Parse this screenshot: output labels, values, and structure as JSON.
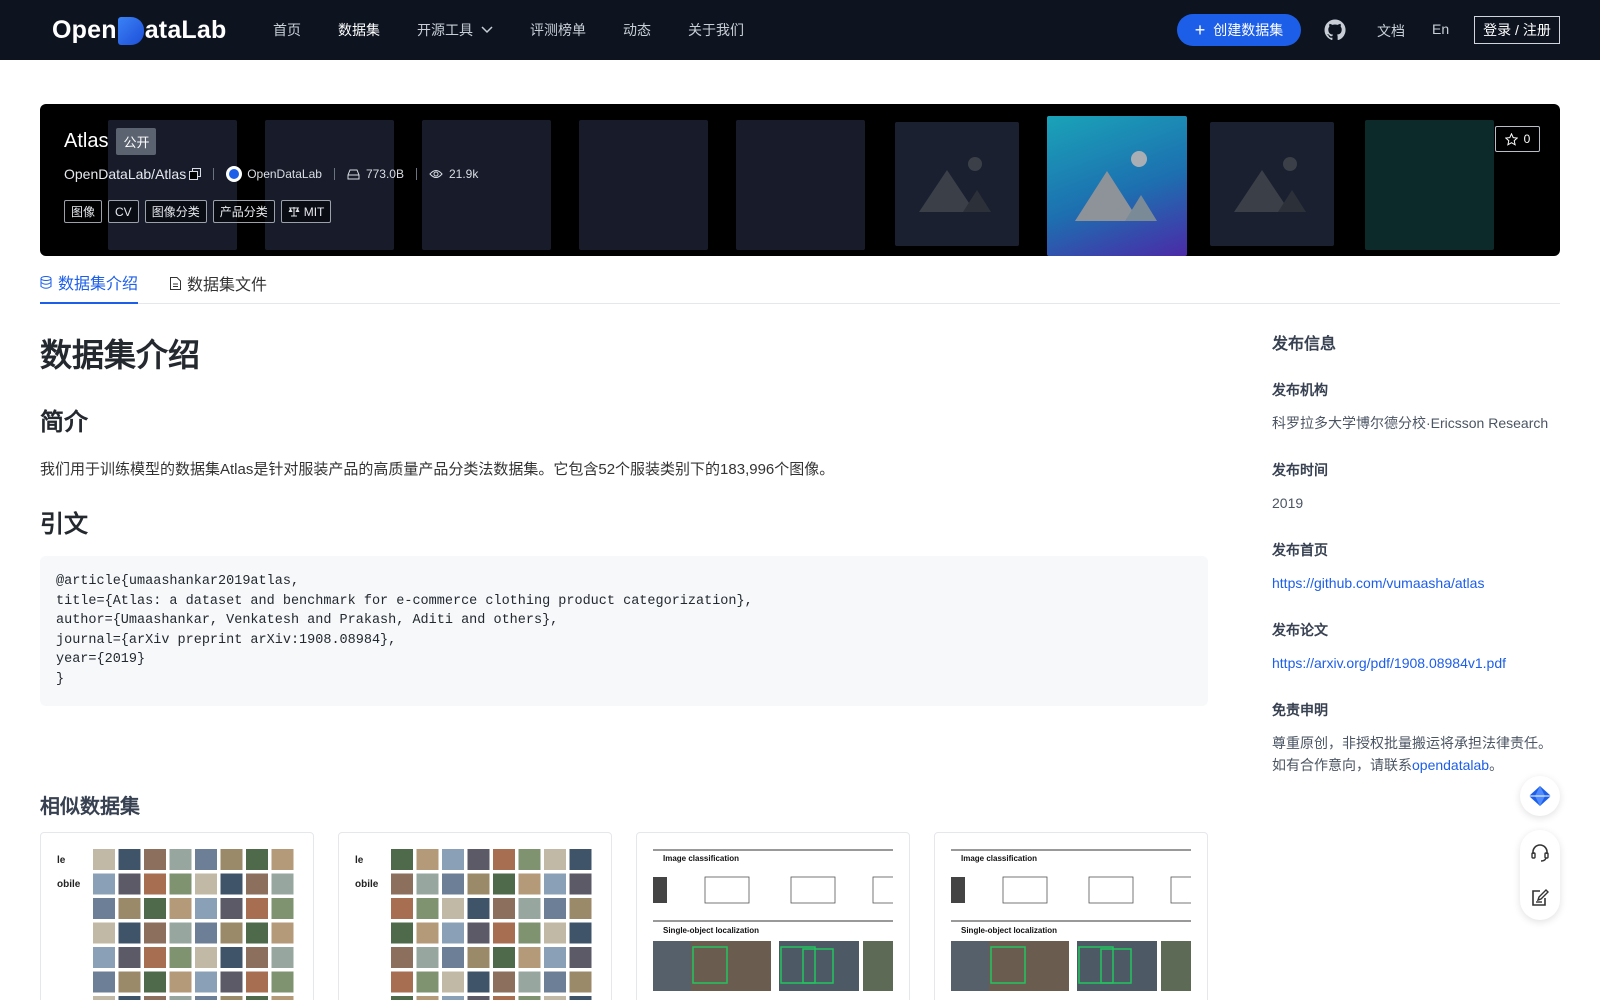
{
  "nav": {
    "logo_pre": "Open",
    "logo_post": "ataLab",
    "links": [
      "首页",
      "数据集",
      "开源工具",
      "评测榜单",
      "动态",
      "关于我们"
    ],
    "active_link": "数据集",
    "create_label": "创建数据集",
    "docs": "文档",
    "lang": "En",
    "login": "登录 / 注册"
  },
  "dataset": {
    "name": "Atlas",
    "visibility": "公开",
    "repo": "OpenDataLab/Atlas",
    "org": "OpenDataLab",
    "size": "773.0B",
    "views": "21.9k",
    "tags": [
      "图像",
      "CV",
      "图像分类",
      "产品分类"
    ],
    "license": "MIT",
    "stars": "0"
  },
  "tabs": [
    {
      "label": "数据集介绍",
      "icon": "database-icon"
    },
    {
      "label": "数据集文件",
      "icon": "file-icon"
    }
  ],
  "content": {
    "title": "数据集介绍",
    "intro_heading": "简介",
    "intro_text": "我们用于训练模型的数据集Atlas是针对服装产品的高质量产品分类法数据集。它包含52个服装类别下的183,996个图像。",
    "citation_heading": "引文",
    "citation": "@article{umaashankar2019atlas,\ntitle={Atlas: a dataset and benchmark for e-commerce clothing product categorization},\nauthor={Umaashankar, Venkatesh and Prakash, Aditi and others},\njournal={arXiv preprint arXiv:1908.08984},\nyear={2019}\n}"
  },
  "sidebar": {
    "title": "发布信息",
    "org_label": "发布机构",
    "org_value": "科罗拉多大学博尔德分校·Ericsson Research",
    "date_label": "发布时间",
    "date_value": "2019",
    "homepage_label": "发布首页",
    "homepage_value": "https://github.com/vumaasha/atlas",
    "paper_label": "发布论文",
    "paper_value": "https://arxiv.org/pdf/1908.08984v1.pdf",
    "disclaimer_label": "免责申明",
    "disclaimer_line1": "尊重原创，非授权批量搬运将承担法律责任。",
    "disclaimer_line2_pre": "如有合作意向，请联系",
    "disclaimer_link": "opendatalab",
    "disclaimer_line2_post": "。"
  },
  "similar": {
    "title": "相似数据集",
    "card1_text": [
      "le",
      "obile"
    ],
    "card3_heading1": "Image classification",
    "card3_heading2": "Single-object localization"
  }
}
